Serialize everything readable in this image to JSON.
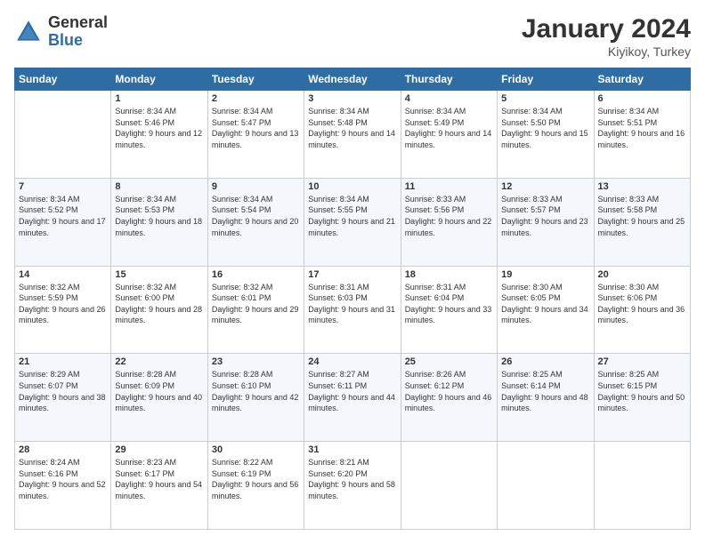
{
  "logo": {
    "general": "General",
    "blue": "Blue"
  },
  "title": "January 2024",
  "location": "Kiyikoy, Turkey",
  "days": [
    "Sunday",
    "Monday",
    "Tuesday",
    "Wednesday",
    "Thursday",
    "Friday",
    "Saturday"
  ],
  "weeks": [
    [
      {
        "num": "",
        "sunrise": "",
        "sunset": "",
        "daylight": ""
      },
      {
        "num": "1",
        "sunrise": "Sunrise: 8:34 AM",
        "sunset": "Sunset: 5:46 PM",
        "daylight": "Daylight: 9 hours and 12 minutes."
      },
      {
        "num": "2",
        "sunrise": "Sunrise: 8:34 AM",
        "sunset": "Sunset: 5:47 PM",
        "daylight": "Daylight: 9 hours and 13 minutes."
      },
      {
        "num": "3",
        "sunrise": "Sunrise: 8:34 AM",
        "sunset": "Sunset: 5:48 PM",
        "daylight": "Daylight: 9 hours and 14 minutes."
      },
      {
        "num": "4",
        "sunrise": "Sunrise: 8:34 AM",
        "sunset": "Sunset: 5:49 PM",
        "daylight": "Daylight: 9 hours and 14 minutes."
      },
      {
        "num": "5",
        "sunrise": "Sunrise: 8:34 AM",
        "sunset": "Sunset: 5:50 PM",
        "daylight": "Daylight: 9 hours and 15 minutes."
      },
      {
        "num": "6",
        "sunrise": "Sunrise: 8:34 AM",
        "sunset": "Sunset: 5:51 PM",
        "daylight": "Daylight: 9 hours and 16 minutes."
      }
    ],
    [
      {
        "num": "7",
        "sunrise": "Sunrise: 8:34 AM",
        "sunset": "Sunset: 5:52 PM",
        "daylight": "Daylight: 9 hours and 17 minutes."
      },
      {
        "num": "8",
        "sunrise": "Sunrise: 8:34 AM",
        "sunset": "Sunset: 5:53 PM",
        "daylight": "Daylight: 9 hours and 18 minutes."
      },
      {
        "num": "9",
        "sunrise": "Sunrise: 8:34 AM",
        "sunset": "Sunset: 5:54 PM",
        "daylight": "Daylight: 9 hours and 20 minutes."
      },
      {
        "num": "10",
        "sunrise": "Sunrise: 8:34 AM",
        "sunset": "Sunset: 5:55 PM",
        "daylight": "Daylight: 9 hours and 21 minutes."
      },
      {
        "num": "11",
        "sunrise": "Sunrise: 8:33 AM",
        "sunset": "Sunset: 5:56 PM",
        "daylight": "Daylight: 9 hours and 22 minutes."
      },
      {
        "num": "12",
        "sunrise": "Sunrise: 8:33 AM",
        "sunset": "Sunset: 5:57 PM",
        "daylight": "Daylight: 9 hours and 23 minutes."
      },
      {
        "num": "13",
        "sunrise": "Sunrise: 8:33 AM",
        "sunset": "Sunset: 5:58 PM",
        "daylight": "Daylight: 9 hours and 25 minutes."
      }
    ],
    [
      {
        "num": "14",
        "sunrise": "Sunrise: 8:32 AM",
        "sunset": "Sunset: 5:59 PM",
        "daylight": "Daylight: 9 hours and 26 minutes."
      },
      {
        "num": "15",
        "sunrise": "Sunrise: 8:32 AM",
        "sunset": "Sunset: 6:00 PM",
        "daylight": "Daylight: 9 hours and 28 minutes."
      },
      {
        "num": "16",
        "sunrise": "Sunrise: 8:32 AM",
        "sunset": "Sunset: 6:01 PM",
        "daylight": "Daylight: 9 hours and 29 minutes."
      },
      {
        "num": "17",
        "sunrise": "Sunrise: 8:31 AM",
        "sunset": "Sunset: 6:03 PM",
        "daylight": "Daylight: 9 hours and 31 minutes."
      },
      {
        "num": "18",
        "sunrise": "Sunrise: 8:31 AM",
        "sunset": "Sunset: 6:04 PM",
        "daylight": "Daylight: 9 hours and 33 minutes."
      },
      {
        "num": "19",
        "sunrise": "Sunrise: 8:30 AM",
        "sunset": "Sunset: 6:05 PM",
        "daylight": "Daylight: 9 hours and 34 minutes."
      },
      {
        "num": "20",
        "sunrise": "Sunrise: 8:30 AM",
        "sunset": "Sunset: 6:06 PM",
        "daylight": "Daylight: 9 hours and 36 minutes."
      }
    ],
    [
      {
        "num": "21",
        "sunrise": "Sunrise: 8:29 AM",
        "sunset": "Sunset: 6:07 PM",
        "daylight": "Daylight: 9 hours and 38 minutes."
      },
      {
        "num": "22",
        "sunrise": "Sunrise: 8:28 AM",
        "sunset": "Sunset: 6:09 PM",
        "daylight": "Daylight: 9 hours and 40 minutes."
      },
      {
        "num": "23",
        "sunrise": "Sunrise: 8:28 AM",
        "sunset": "Sunset: 6:10 PM",
        "daylight": "Daylight: 9 hours and 42 minutes."
      },
      {
        "num": "24",
        "sunrise": "Sunrise: 8:27 AM",
        "sunset": "Sunset: 6:11 PM",
        "daylight": "Daylight: 9 hours and 44 minutes."
      },
      {
        "num": "25",
        "sunrise": "Sunrise: 8:26 AM",
        "sunset": "Sunset: 6:12 PM",
        "daylight": "Daylight: 9 hours and 46 minutes."
      },
      {
        "num": "26",
        "sunrise": "Sunrise: 8:25 AM",
        "sunset": "Sunset: 6:14 PM",
        "daylight": "Daylight: 9 hours and 48 minutes."
      },
      {
        "num": "27",
        "sunrise": "Sunrise: 8:25 AM",
        "sunset": "Sunset: 6:15 PM",
        "daylight": "Daylight: 9 hours and 50 minutes."
      }
    ],
    [
      {
        "num": "28",
        "sunrise": "Sunrise: 8:24 AM",
        "sunset": "Sunset: 6:16 PM",
        "daylight": "Daylight: 9 hours and 52 minutes."
      },
      {
        "num": "29",
        "sunrise": "Sunrise: 8:23 AM",
        "sunset": "Sunset: 6:17 PM",
        "daylight": "Daylight: 9 hours and 54 minutes."
      },
      {
        "num": "30",
        "sunrise": "Sunrise: 8:22 AM",
        "sunset": "Sunset: 6:19 PM",
        "daylight": "Daylight: 9 hours and 56 minutes."
      },
      {
        "num": "31",
        "sunrise": "Sunrise: 8:21 AM",
        "sunset": "Sunset: 6:20 PM",
        "daylight": "Daylight: 9 hours and 58 minutes."
      },
      {
        "num": "",
        "sunrise": "",
        "sunset": "",
        "daylight": ""
      },
      {
        "num": "",
        "sunrise": "",
        "sunset": "",
        "daylight": ""
      },
      {
        "num": "",
        "sunrise": "",
        "sunset": "",
        "daylight": ""
      }
    ]
  ]
}
